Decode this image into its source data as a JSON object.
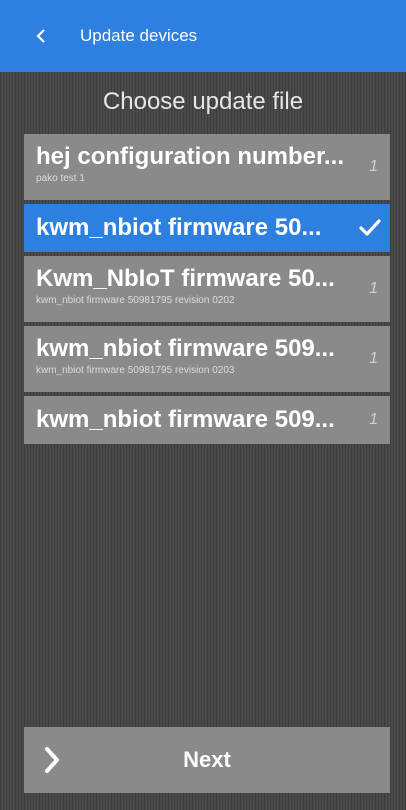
{
  "appbar": {
    "title": "Update devices",
    "back_icon": "chevron-left-icon",
    "color": "#2d7fe0"
  },
  "page": {
    "title": "Choose update file"
  },
  "files": [
    {
      "title": "hej configuration number...",
      "subtitle": "pako test 1",
      "count": "1",
      "selected": false
    },
    {
      "title": "kwm_nbiot firmware 50...",
      "subtitle": "",
      "count": "",
      "selected": true
    },
    {
      "title": "Kwm_NbIoT firmware 50...",
      "subtitle": "kwm_nbiot firmware 50981795 revision 0202",
      "count": "1",
      "selected": false
    },
    {
      "title": "kwm_nbiot firmware 509...",
      "subtitle": "kwm_nbiot firmware 50981795 revision 0203",
      "count": "1",
      "selected": false
    },
    {
      "title": "kwm_nbiot firmware 509...",
      "subtitle": "",
      "count": "1",
      "selected": false
    }
  ],
  "next_button": {
    "label": "Next",
    "icon": "chevron-right-icon"
  }
}
